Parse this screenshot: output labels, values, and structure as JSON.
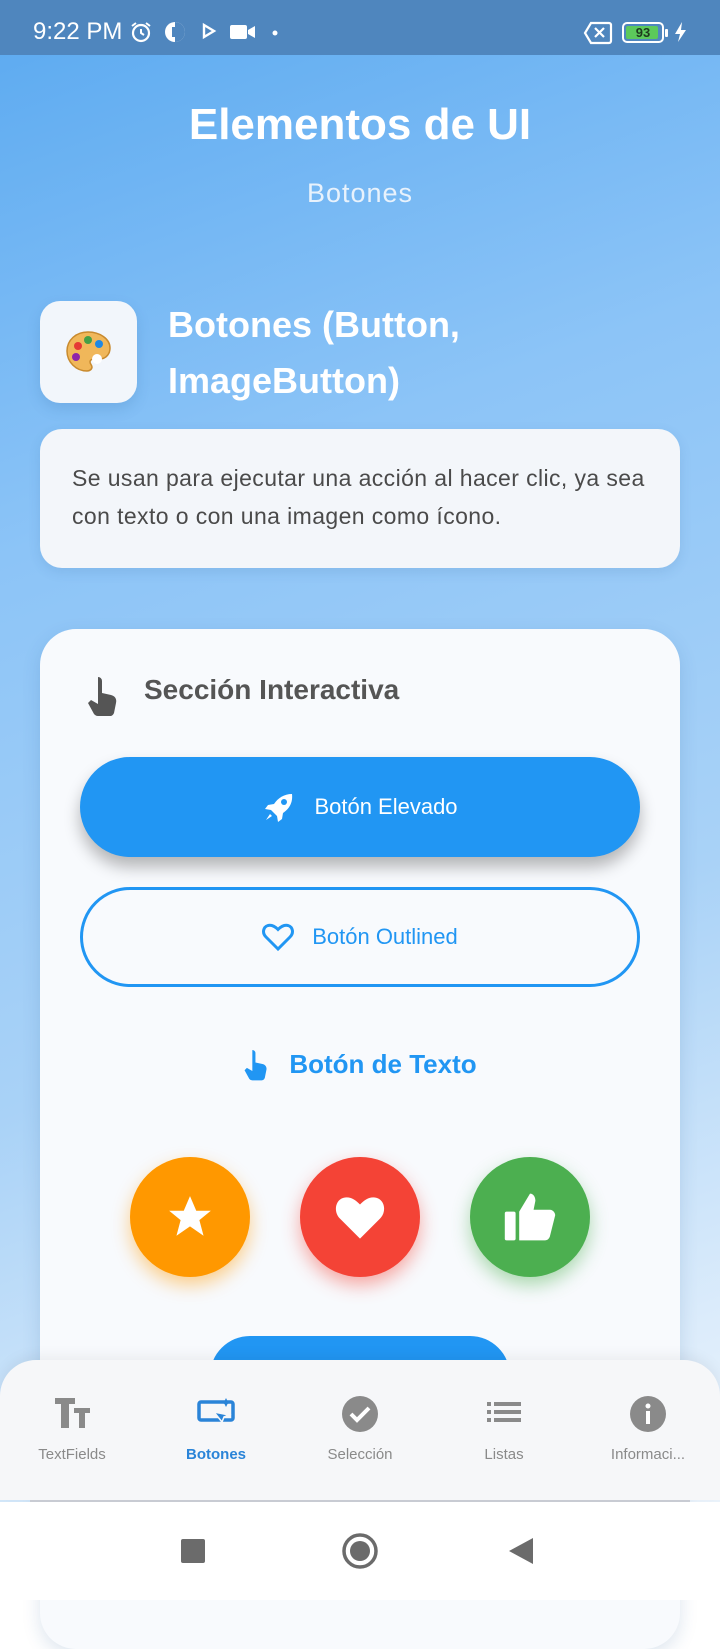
{
  "status_bar": {
    "time": "9:22 PM",
    "battery_level": "93",
    "icons": [
      "alarm-icon",
      "data-saver-icon",
      "play-icon",
      "video-camera-icon",
      "dot-icon",
      "no-sim-icon",
      "battery-icon",
      "charging-icon"
    ]
  },
  "header": {
    "title": "Elementos de UI",
    "subtitle": "Botones"
  },
  "section": {
    "icon": "palette-icon",
    "title": "Botones (Button, ImageButton)",
    "description": "Se usan para ejecutar una acción al hacer clic, ya sea con texto o con una imagen como ícono."
  },
  "interactive": {
    "title": "Sección Interactiva",
    "elevated_button": "Botón Elevado",
    "outlined_button": "Botón Outlined",
    "text_button": "Botón de Texto",
    "icon_buttons": [
      "star-icon",
      "heart-icon",
      "thumbs-up-icon"
    ]
  },
  "bottom_nav": {
    "items": [
      {
        "label": "TextFields",
        "icon": "text-fields-icon",
        "active": false
      },
      {
        "label": "Botones",
        "icon": "smart-button-icon",
        "active": true
      },
      {
        "label": "Selección",
        "icon": "check-circle-icon",
        "active": false
      },
      {
        "label": "Listas",
        "icon": "list-icon",
        "active": false
      },
      {
        "label": "Informaci...",
        "icon": "info-icon",
        "active": false
      }
    ]
  },
  "colors": {
    "primary": "#2196f3",
    "orange": "#ff9800",
    "red": "#f44336",
    "green": "#4caf50",
    "active_nav": "#2a84d8"
  }
}
